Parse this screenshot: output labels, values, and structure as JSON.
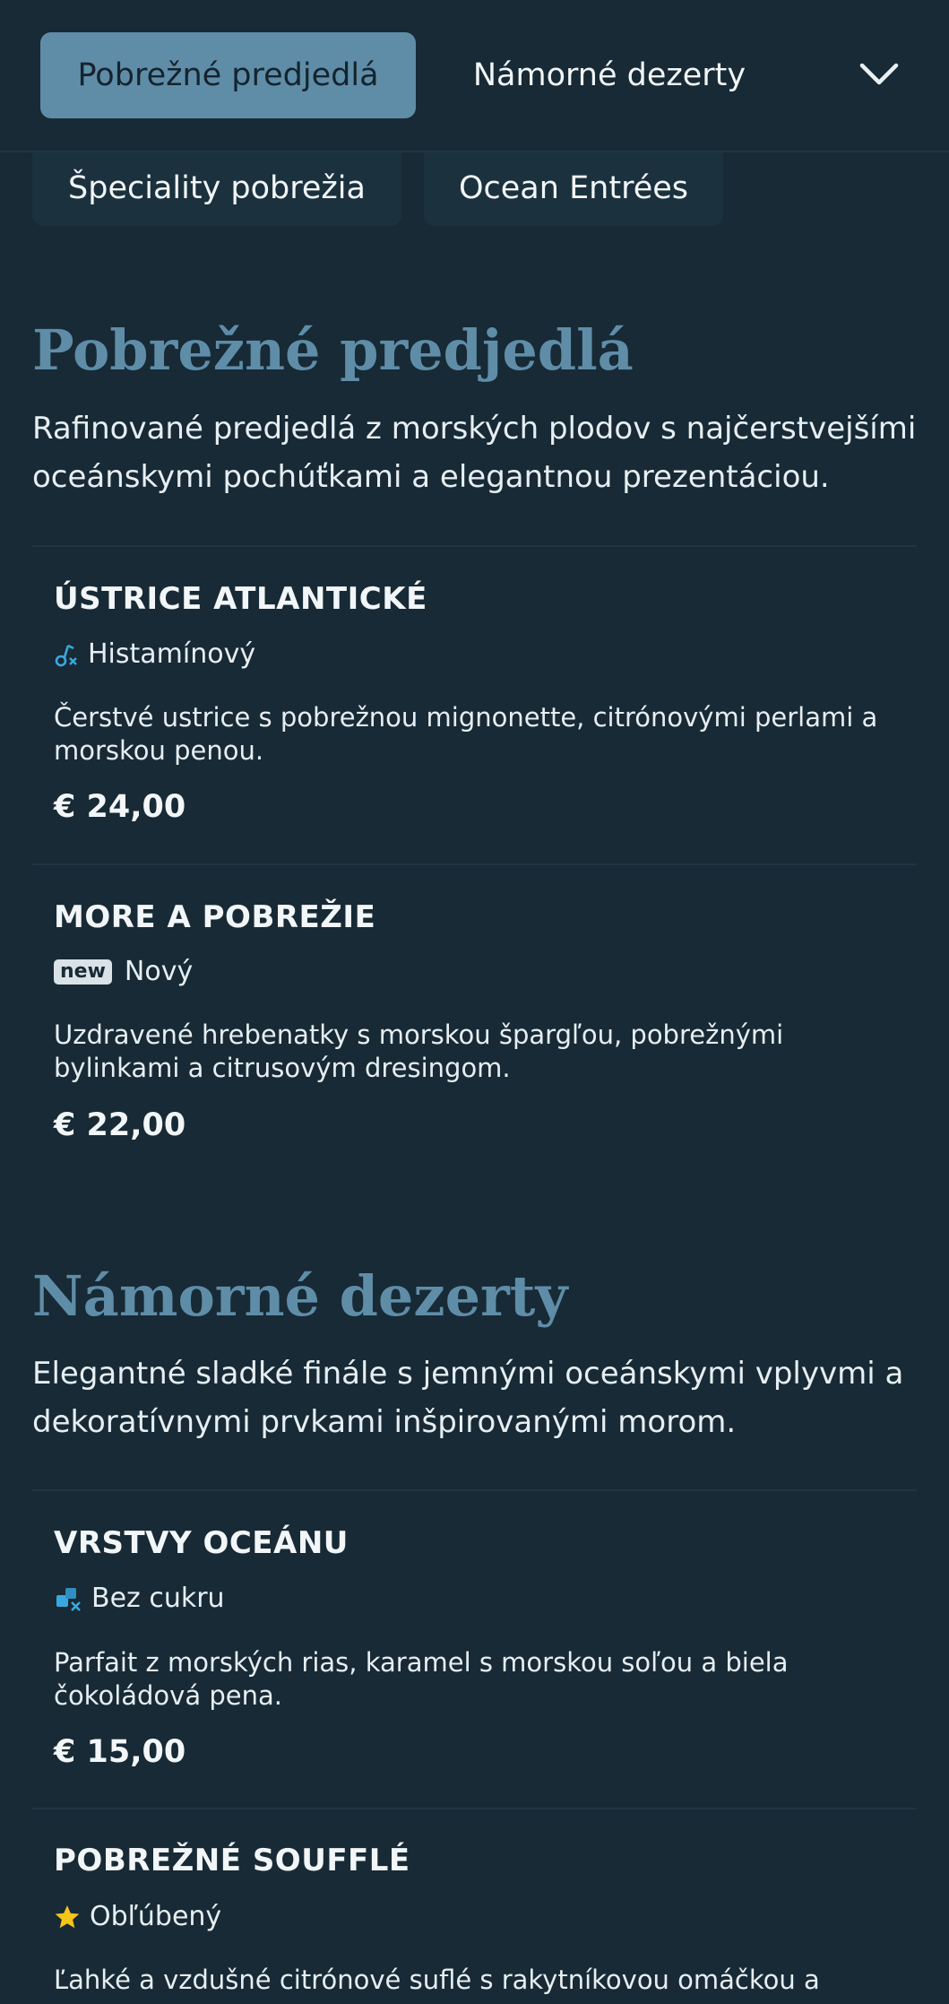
{
  "nav": {
    "tabs": [
      {
        "label": "Pobrežné predjedlá",
        "active": true
      },
      {
        "label": "Námorné dezerty",
        "active": false
      },
      {
        "label": "Špeciality pobrežia",
        "active": false
      },
      {
        "label": "Ocean Entrées",
        "active": false
      }
    ],
    "dropdown_icon": "chevron-down-icon"
  },
  "sections": [
    {
      "title": "Pobrežné predjedlá",
      "description": "Rafinované predjedlá z morských plodov s najčerstvejšími oceánskymi pochúťkami a elegantnou prezentáciou.",
      "items": [
        {
          "name": "ÚSTRICE ATLANTICKÉ",
          "tag": "Histamínový",
          "tag_icon": "histamine-icon",
          "description": "Čerstvé ustrice s pobrežnou mignonette, citrónovými perlami a morskou penou.",
          "price": "€ 24,00"
        },
        {
          "name": "MORE A POBREŽIE",
          "tag": "Nový",
          "tag_badge": "new",
          "description": "Uzdravené hrebenatky s morskou špargľou, pobrežnými bylinkami a citrusovým dresingom.",
          "price": "€ 22,00"
        }
      ]
    },
    {
      "title": "Námorné dezerty",
      "description": "Elegantné sladké finále s jemnými oceánskymi vplyvmi a dekoratívnymi prvkami inšpirovanými morom.",
      "items": [
        {
          "name": "VRSTVY OCEÁNU",
          "tag": "Bez cukru",
          "tag_icon": "sugar-free-icon",
          "description": "Parfait z morských rias, karamel s morskou soľou a biela čokoládová pena.",
          "price": "€ 15,00"
        },
        {
          "name": "POBREŽNÉ SOUFFLÉ",
          "tag": "Obľúbený",
          "tag_icon": "star-icon",
          "description": "Ľahké a vzdušné citrónové suflé s rakytníkovou omáčkou a",
          "price": ""
        }
      ]
    }
  ],
  "colors": {
    "background": "#172a35",
    "accent": "#5f8da8",
    "icon_blue": "#3aa8e0",
    "star": "#f5c518"
  }
}
